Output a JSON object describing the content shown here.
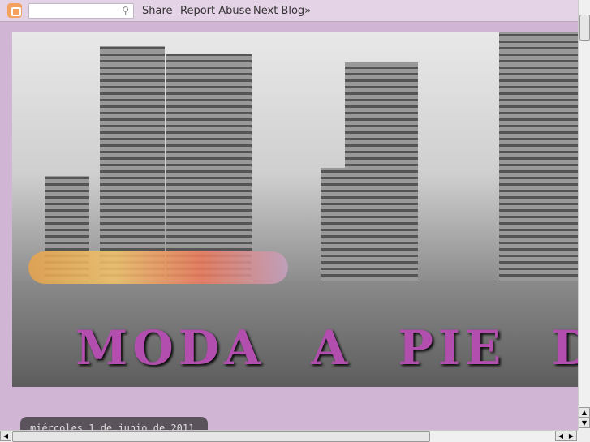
{
  "navbar": {
    "search_placeholder": "",
    "share": "Share",
    "report_abuse": "Report Abuse",
    "next_blog": "Next Blog»"
  },
  "header": {
    "title": "MODA A PIE DE C"
  },
  "post": {
    "date": "miércoles 1 de junio de 2011"
  },
  "colors": {
    "background": "#d1b5d5",
    "navbar": "#e4d3e6",
    "title": "#b24fae",
    "date_tab": "#5b535c"
  }
}
